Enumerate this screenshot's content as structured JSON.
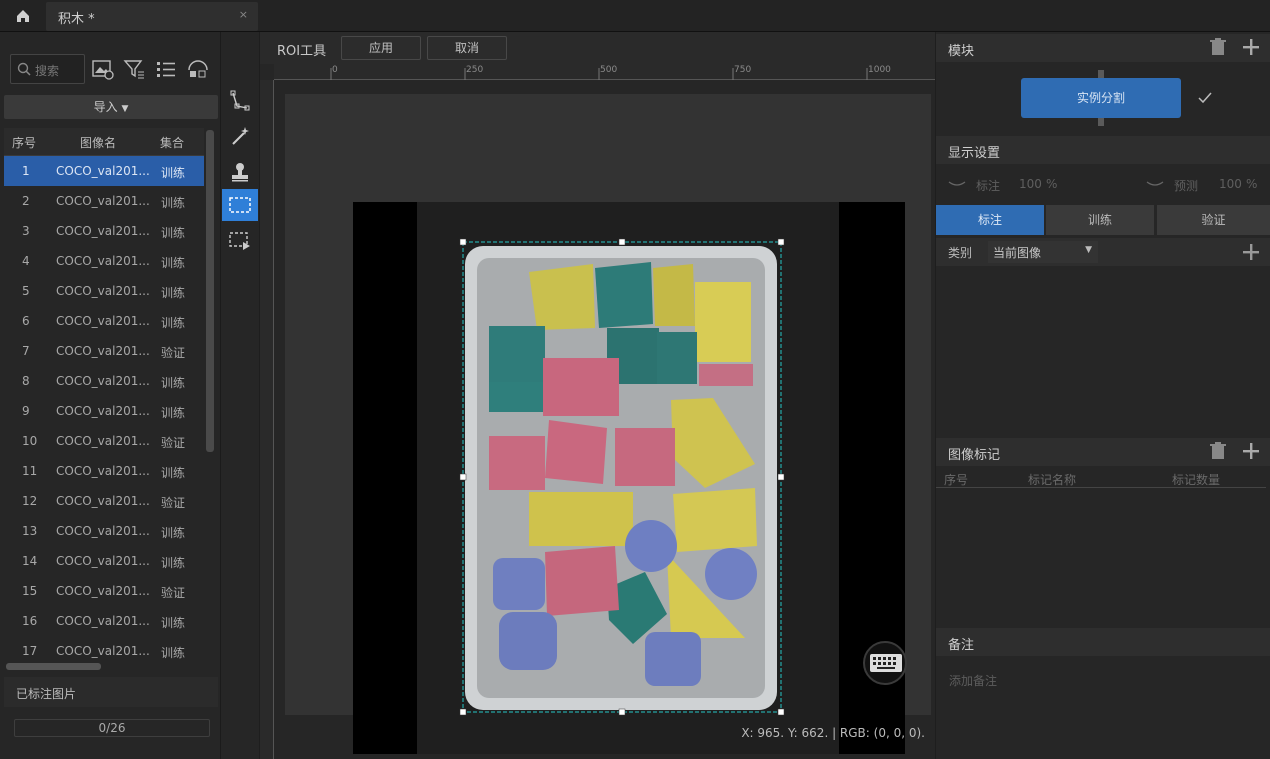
{
  "tab": {
    "title": "积木 *",
    "close": "×"
  },
  "left_panel": {
    "search_placeholder": "搜索",
    "import_label": "导入",
    "columns": [
      "序号",
      "图像名",
      "集合"
    ],
    "rows": [
      {
        "index": "1",
        "name": "COCO_val201...",
        "set": "训练",
        "selected": true
      },
      {
        "index": "2",
        "name": "COCO_val201...",
        "set": "训练"
      },
      {
        "index": "3",
        "name": "COCO_val201...",
        "set": "训练"
      },
      {
        "index": "4",
        "name": "COCO_val201...",
        "set": "训练"
      },
      {
        "index": "5",
        "name": "COCO_val201...",
        "set": "训练"
      },
      {
        "index": "6",
        "name": "COCO_val201...",
        "set": "训练"
      },
      {
        "index": "7",
        "name": "COCO_val201...",
        "set": "验证"
      },
      {
        "index": "8",
        "name": "COCO_val201...",
        "set": "训练"
      },
      {
        "index": "9",
        "name": "COCO_val201...",
        "set": "训练"
      },
      {
        "index": "10",
        "name": "COCO_val201...",
        "set": "验证"
      },
      {
        "index": "11",
        "name": "COCO_val201...",
        "set": "训练"
      },
      {
        "index": "12",
        "name": "COCO_val201...",
        "set": "验证"
      },
      {
        "index": "13",
        "name": "COCO_val201...",
        "set": "训练"
      },
      {
        "index": "14",
        "name": "COCO_val201...",
        "set": "训练"
      },
      {
        "index": "15",
        "name": "COCO_val201...",
        "set": "验证"
      },
      {
        "index": "16",
        "name": "COCO_val201...",
        "set": "训练"
      },
      {
        "index": "17",
        "name": "COCO_val201...",
        "set": "训练"
      }
    ],
    "labeled_title": "已标注图片",
    "progress": "0/26"
  },
  "roi_toolbar": {
    "title": "ROI工具",
    "apply": "应用",
    "cancel": "取消"
  },
  "ruler": {
    "h_marks": [
      "0",
      "250",
      "500",
      "750",
      "1000"
    ]
  },
  "status": {
    "coords": "X: 965. Y: 662. | RGB: (0, 0, 0)."
  },
  "right_panel": {
    "module_title": "模块",
    "module_button": "实例分割",
    "display_title": "显示设置",
    "label_toggle": "标注",
    "label_opacity": "100",
    "predict_toggle": "预测",
    "predict_opacity": "100",
    "percent": "%",
    "segments": [
      "标注",
      "训练",
      "验证"
    ],
    "category_label": "类别",
    "category_value": "当前图像",
    "image_marks_title": "图像标记",
    "marks_columns": [
      "序号",
      "标记名称",
      "标记数量"
    ],
    "notes_title": "备注",
    "notes_placeholder": "添加备注"
  },
  "colors": {
    "accent": "#2f7fd8",
    "selected_row": "#2a5ea8",
    "module_btn": "#2f6cb3",
    "roi_line": "#26c6c6"
  }
}
